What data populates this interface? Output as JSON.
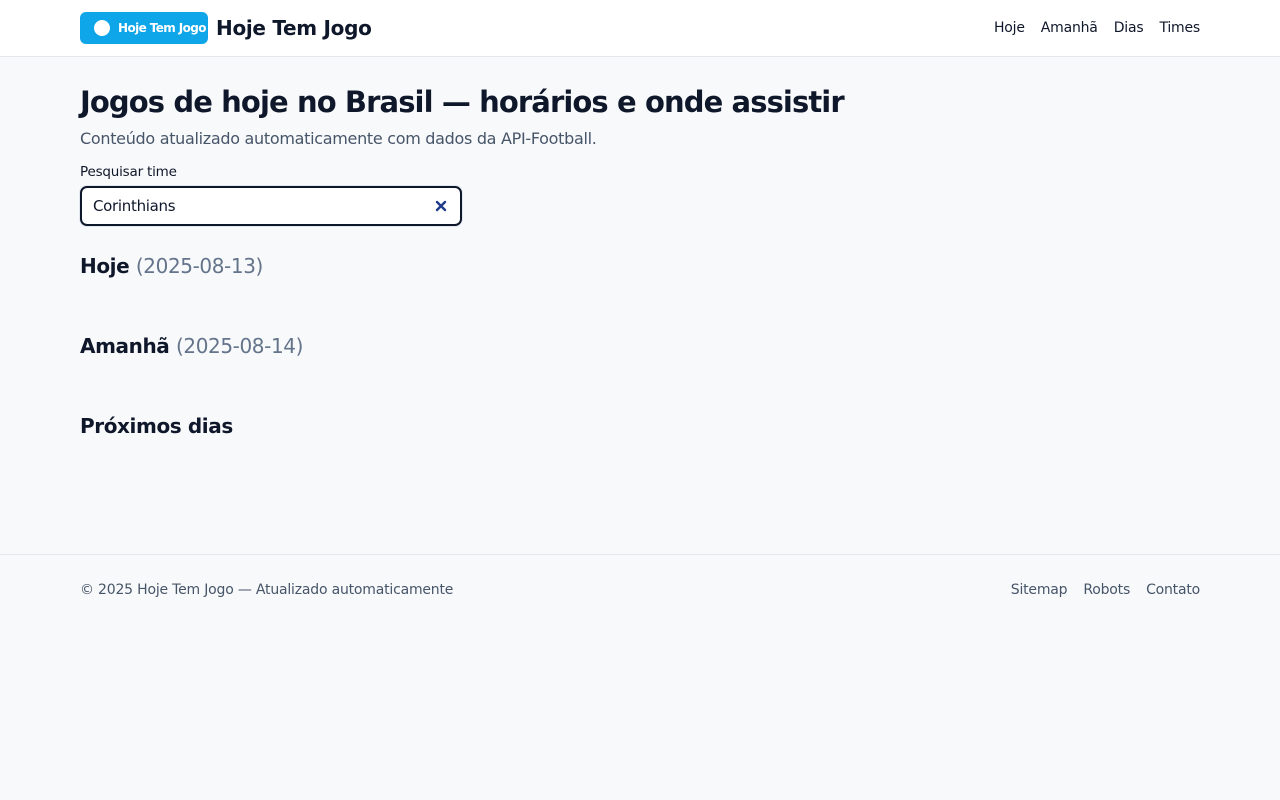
{
  "header": {
    "logo_text": "Hoje Tem Jogo",
    "site_name": "Hoje Tem Jogo",
    "nav": [
      "Hoje",
      "Amanhã",
      "Dias",
      "Times"
    ]
  },
  "main": {
    "title": "Jogos de hoje no Brasil — horários e onde assistir",
    "subtitle": "Conteúdo atualizado automaticamente com dados da API-Football.",
    "search": {
      "label": "Pesquisar time",
      "value": "Corinthians"
    },
    "sections": [
      {
        "title": "Hoje",
        "date": "(2025-08-13)"
      },
      {
        "title": "Amanhã",
        "date": "(2025-08-14)"
      },
      {
        "title": "Próximos dias",
        "date": ""
      }
    ]
  },
  "footer": {
    "copyright": "© 2025 Hoje Tem Jogo — Atualizado automaticamente",
    "links": [
      "Sitemap",
      "Robots",
      "Contato"
    ]
  },
  "colors": {
    "brand": "#0ea5e9",
    "background": "#f8f9fb",
    "text": "#0f172a",
    "muted": "#64748b",
    "clear_icon": "#1e3a8a"
  },
  "icons": {
    "logo": "ball-icon",
    "clear": "close-icon"
  }
}
